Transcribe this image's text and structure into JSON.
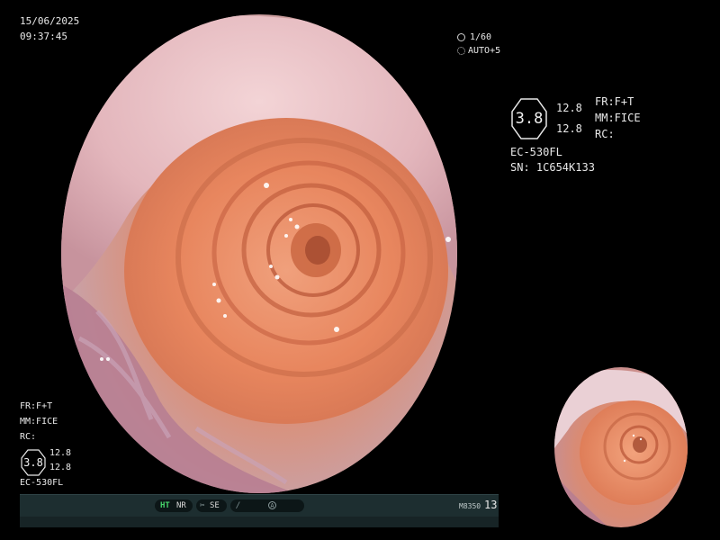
{
  "datetime": {
    "date": "15/06/2025",
    "time": "09:37:45"
  },
  "exposure": {
    "shutter": "1/60",
    "auto": "AUTO+5",
    "shutter_icon": "camera-shutter-icon",
    "auto_icon": "iris-icon"
  },
  "info_panel_right": {
    "enhancement": "3.8",
    "value_top": "12.8",
    "value_bottom": "12.8",
    "fr": "FR:F+T",
    "mm": "MM:FICE",
    "rc": "RC:",
    "scope_model": "EC-530FL",
    "serial": "SN: 1C654K133"
  },
  "info_panel_left": {
    "fr": "FR:F+T",
    "mm": "MM:FICE",
    "rc": "RC:",
    "enhancement": "3.8",
    "value_top": "12.8",
    "value_bottom": "12.8",
    "scope_model": "EC-530FL"
  },
  "status_bar": {
    "ht": "HT",
    "nr": "NR",
    "se": "SE",
    "se_icon": "scissor-icon",
    "flash_icon": "lightning-icon",
    "a_icon": "circle-a-icon",
    "model": "M8350",
    "count": "13"
  },
  "colors": {
    "background": "#000000",
    "status_bar": "#1d2e30",
    "ht_green": "#46d36a",
    "text": "#e8e8e8"
  }
}
